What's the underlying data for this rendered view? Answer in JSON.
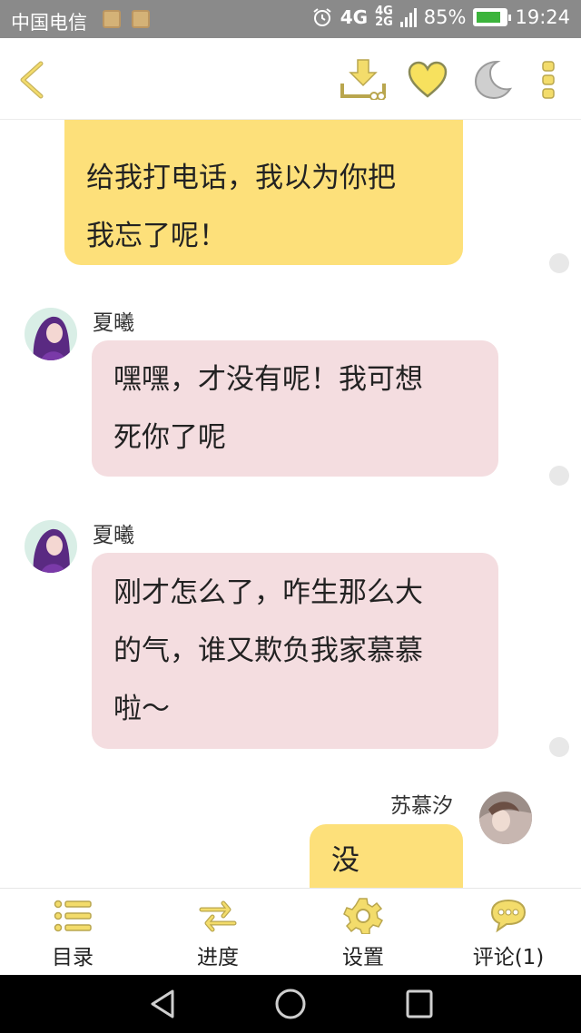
{
  "status_bar": {
    "carrier": "中国电信",
    "network_label": "4G",
    "network_sub_top": "4G",
    "network_sub_bottom": "2G",
    "battery_percent": "85%",
    "time": "19:24"
  },
  "header": {
    "back_icon": "chevron-left-icon",
    "download_icon": "download-icon",
    "favorite_icon": "heart-icon",
    "night_mode_icon": "moon-icon",
    "more_icon": "more-vertical-icon",
    "accent_color": "#f3dc6b"
  },
  "chat": {
    "messages": [
      {
        "side": "right",
        "sender": "",
        "text_lines": [
          "给我打电话，我以为你把",
          "我忘了呢！"
        ],
        "color": "#fde07a"
      },
      {
        "side": "left",
        "sender": "夏曦",
        "text_lines": [
          "嘿嘿，才没有呢！我可想",
          "死你了呢"
        ],
        "color": "#f4dde0"
      },
      {
        "side": "left",
        "sender": "夏曦",
        "text_lines": [
          "刚才怎么了，咋生那么大",
          "的气，谁又欺负我家慕慕",
          "啦～"
        ],
        "color": "#f4dde0"
      },
      {
        "side": "right",
        "sender": "苏慕汐",
        "text_lines": [
          "没事……"
        ],
        "color": "#fde07a"
      }
    ]
  },
  "toolbar": {
    "items": [
      {
        "label": "目录",
        "icon": "list-icon"
      },
      {
        "label": "进度",
        "icon": "swap-arrows-icon"
      },
      {
        "label": "设置",
        "icon": "gear-icon"
      },
      {
        "label": "评论(1)",
        "icon": "comment-bubble-icon"
      }
    ]
  },
  "nav_bar": {
    "back": "triangle-back-icon",
    "home": "circle-home-icon",
    "recents": "square-recents-icon"
  }
}
